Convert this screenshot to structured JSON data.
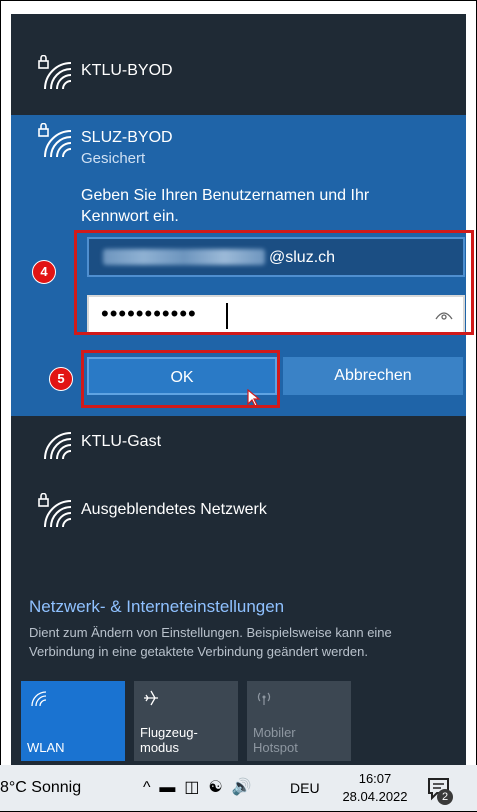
{
  "networks": {
    "top": {
      "name": "KTLU-BYOD"
    },
    "selected": {
      "name": "SLUZ-BYOD",
      "status": "Gesichert",
      "prompt": "Geben Sie Ihren Benutzernamen und Ihr Kennwort ein.",
      "username_domain": "@sluz.ch",
      "password_masked": "•••••••••••",
      "ok_label": "OK",
      "cancel_label": "Abbrechen"
    },
    "guest": {
      "name": "KTLU-Gast"
    },
    "hidden": {
      "name": "Ausgeblendetes Netzwerk"
    }
  },
  "annotations": {
    "badge_fields": "4",
    "badge_ok": "5"
  },
  "settings": {
    "title": "Netzwerk- & Interneteinstellungen",
    "description": "Dient zum Ändern von Einstellungen. Beispielsweise kann eine Verbindung in eine getaktete Verbindung geändert werden."
  },
  "quick_tiles": {
    "wlan": "WLAN",
    "airplane_line1": "Flugzeug-",
    "airplane_line2": "modus",
    "hotspot_line1": "Mobiler",
    "hotspot_line2": "Hotspot"
  },
  "taskbar": {
    "weather": "8°C Sonnig",
    "language": "DEU",
    "time": "16:07",
    "date": "28.04.2022",
    "notification_count": "2"
  },
  "colors": {
    "panel": "#1f2a35",
    "selected": "#1f64a8",
    "accent": "#1a73d1",
    "highlight": "#d11a1a"
  }
}
